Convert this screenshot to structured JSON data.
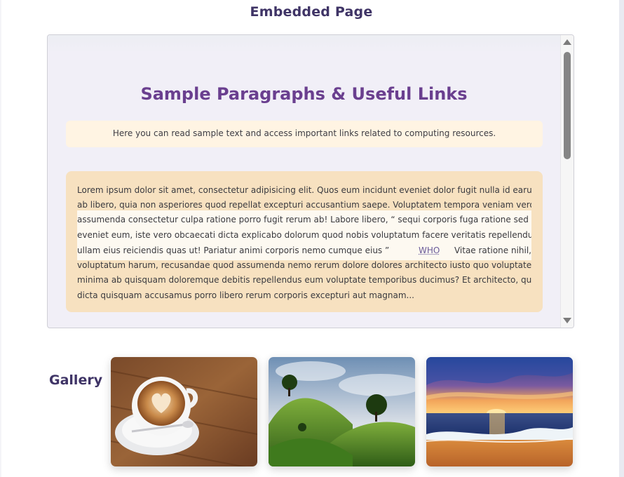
{
  "header": {
    "title": "Embedded Page"
  },
  "embedded": {
    "title": "Sample Paragraphs & Useful Links",
    "intro": "Here you can read sample text and access important links related to computing resources.",
    "paragraph_lines": [
      "Lorem ipsum dolor sit amet, consectetur adipisicing elit. Quos eum incidunt eveniet dolor fugit nulla id earum",
      "ab libero, quia non asperiores quod repellat excepturi accusantium saepe. Voluptatem tempora veniam vero",
      "assumenda consectetur culpa ratione porro fugit rerum ab! Labore libero, “ sequi corporis fuga ratione sed",
      "eveniet eum, iste vero obcaecati dicta explicabo dolorum quod nobis voluptatum facere veritatis repellendus",
      "ullam eius reiciendis quas ut! Pariatur animi corporis nemo cumque eius ”",
      "voluptatum harum, recusandae quod assumenda nemo rerum dolore dolores architecto iusto quo voluptates",
      "minima ab quisquam doloremque debitis repellendus eum voluptate temporibus ducimus? Et architecto, quae",
      "dicta quisquam accusamus porro libero rerum corporis excepturi aut magnam..."
    ],
    "link_label": "WHO",
    "after_link": "Vitae ratione nihil,"
  },
  "gallery": {
    "label": "Gallery",
    "items": [
      {
        "name": "coffee-latte-art-image"
      },
      {
        "name": "green-hills-trees-image"
      },
      {
        "name": "ocean-sunset-image"
      }
    ]
  },
  "colors": {
    "heading": "#3f3466",
    "inner_title": "#6a3f8f",
    "intro_bg": "#fff4e3",
    "paragraph_bg": "#f7e1c0"
  }
}
